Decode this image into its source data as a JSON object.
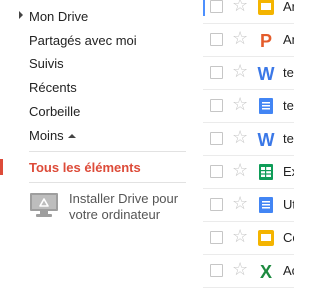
{
  "sidebar": {
    "my_drive": "Mon Drive",
    "shared": "Partagés avec moi",
    "starred": "Suivis",
    "recent": "Récents",
    "trash": "Corbeille",
    "less": "Moins",
    "all_items": "Tous les éléments",
    "install_line1": "Installer Drive pour",
    "install_line2": "votre ordinateur"
  },
  "files": [
    {
      "name": "Ar",
      "type": "slides"
    },
    {
      "name": "An",
      "type": "powerpoint"
    },
    {
      "name": "te",
      "type": "word"
    },
    {
      "name": "te",
      "type": "document"
    },
    {
      "name": "te",
      "type": "word"
    },
    {
      "name": "Ex",
      "type": "spreadsheet"
    },
    {
      "name": "Ut",
      "type": "document"
    },
    {
      "name": "Co",
      "type": "slides"
    },
    {
      "name": "Ac",
      "type": "excel"
    }
  ],
  "colors": {
    "accent_red": "#dd4b39",
    "doc_blue": "#4285f4",
    "sheet_green": "#0f9d58",
    "slides_yellow": "#f4b400",
    "ppt_orange": "#e45c2b",
    "word_blue": "#3b78e7",
    "excel_green": "#1d8a3f"
  }
}
